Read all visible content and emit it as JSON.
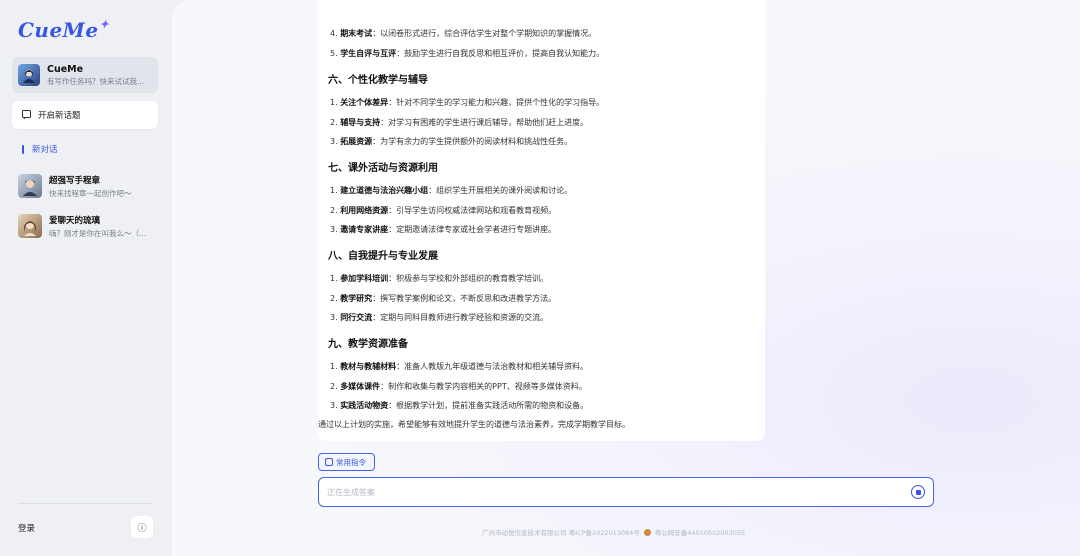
{
  "brand": {
    "name": "CueMe",
    "spark": "✦"
  },
  "bot": {
    "name": "CueMe",
    "desc": "有写作任务吗？快来试试我..."
  },
  "sidebar": {
    "new_topic": "开启新话题",
    "new_conversation": "新对话",
    "conversations": [
      {
        "title": "超强写手程章",
        "sub": "快来找程章一起创作吧～"
      },
      {
        "title": "爱聊天的琉璃",
        "sub": "嗨？刚才是你在叫我么～（..."
      }
    ],
    "login": "登录",
    "info_icon": "ⓘ"
  },
  "answer": {
    "lines": [
      {
        "num": "4.",
        "bold": "期末考试",
        "rest": "：以闭卷形式进行，综合评估学生对整个学期知识的掌握情况。"
      },
      {
        "num": "5.",
        "bold": "学生自评与互评",
        "rest": "：鼓励学生进行自我反思和相互评价，提高自我认知能力。"
      }
    ],
    "sections": [
      {
        "title": "六、个性化教学与辅导",
        "items": [
          {
            "num": "1.",
            "bold": "关注个体差异",
            "rest": "：针对不同学生的学习能力和兴趣，提供个性化的学习指导。"
          },
          {
            "num": "2.",
            "bold": "辅导与支持",
            "rest": "：对学习有困难的学生进行课后辅导，帮助他们赶上进度。"
          },
          {
            "num": "3.",
            "bold": "拓展资源",
            "rest": "：为学有余力的学生提供额外的阅读材料和挑战性任务。"
          }
        ]
      },
      {
        "title": "七、课外活动与资源利用",
        "items": [
          {
            "num": "1.",
            "bold": "建立道德与法治兴趣小组",
            "rest": "：组织学生开展相关的课外阅读和讨论。"
          },
          {
            "num": "2.",
            "bold": "利用网络资源",
            "rest": "：引导学生访问权威法律网站和观看教育视频。"
          },
          {
            "num": "3.",
            "bold": "邀请专家讲座",
            "rest": "：定期邀请法律专家或社会学者进行专题讲座。"
          }
        ]
      },
      {
        "title": "八、自我提升与专业发展",
        "items": [
          {
            "num": "1.",
            "bold": "参加学科培训",
            "rest": "：积极参与学校和外部组织的教育教学培训。"
          },
          {
            "num": "2.",
            "bold": "教学研究",
            "rest": "：撰写教学案例和论文，不断反思和改进教学方法。"
          },
          {
            "num": "3.",
            "bold": "同行交流",
            "rest": "：定期与同科目教师进行教学经验和资源的交流。"
          }
        ]
      },
      {
        "title": "九、教学资源准备",
        "items": [
          {
            "num": "1.",
            "bold": "教材与教辅材料",
            "rest": "：准备人教版九年级道德与法治教材和相关辅导资料。"
          },
          {
            "num": "2.",
            "bold": "多媒体课件",
            "rest": "：制作和收集与教学内容相关的PPT、视频等多媒体资料。"
          },
          {
            "num": "3.",
            "bold": "实践活动物资",
            "rest": "：根据教学计划，提前准备实践活动所需的物资和设备。"
          }
        ]
      }
    ],
    "summary": "通过以上计划的实施，希望能够有效地提升学生的道德与法治素养，完成学期教学目标。"
  },
  "composer": {
    "chip_label": "常用指令",
    "placeholder": "正在生成答案"
  },
  "footer": {
    "company": "广州市动悦信息技术有限公司 粤ICP备2022013084号",
    "police": "粤公网安备44010502003055"
  },
  "colors": {
    "accent": "#3656e3",
    "sidebar_bg": "#eef0f3"
  }
}
